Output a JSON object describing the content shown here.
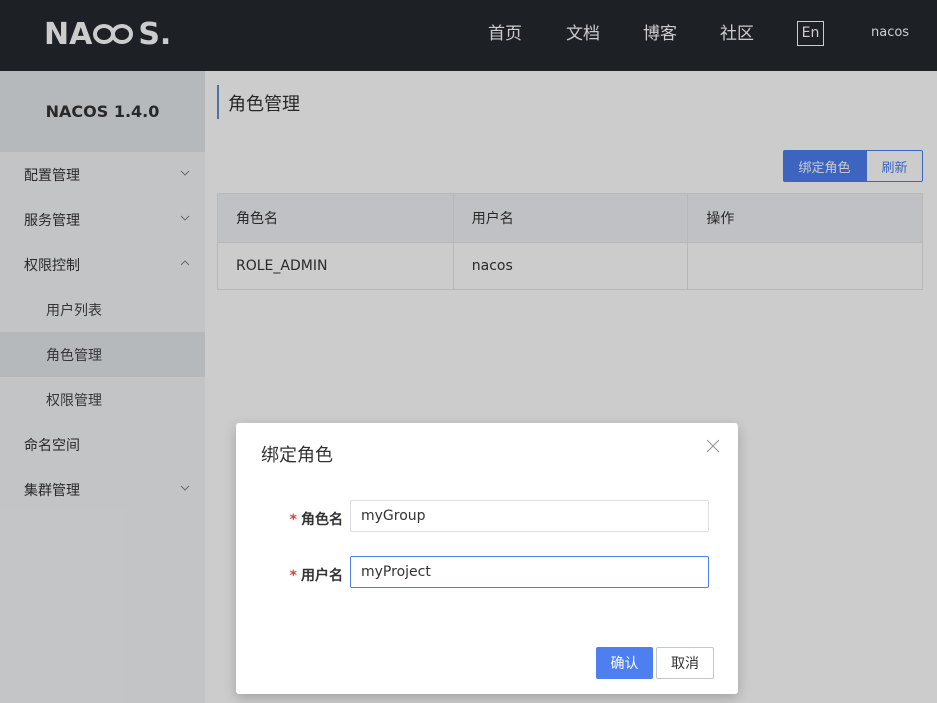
{
  "header": {
    "logo_left": "NA",
    "logo_right": "S.",
    "nav": [
      "首页",
      "文档",
      "博客",
      "社区"
    ],
    "lang": "En",
    "username": "nacos"
  },
  "sidebar": {
    "title": "NACOS 1.4.0",
    "items": [
      {
        "label": "配置管理",
        "chevron": "down"
      },
      {
        "label": "服务管理",
        "chevron": "down"
      },
      {
        "label": "权限控制",
        "chevron": "up"
      },
      {
        "label": "用户列表"
      },
      {
        "label": "角色管理",
        "active": true
      },
      {
        "label": "权限管理"
      },
      {
        "label": "命名空间"
      },
      {
        "label": "集群管理",
        "chevron": "down"
      }
    ]
  },
  "main": {
    "title": "角色管理",
    "bind_button": "绑定角色",
    "refresh_button": "刷新",
    "table": {
      "columns": [
        "角色名",
        "用户名",
        "操作"
      ],
      "rows": [
        [
          "ROLE_ADMIN",
          "nacos",
          ""
        ]
      ]
    }
  },
  "dialog": {
    "title": "绑定角色",
    "role_label": "角色名",
    "role_value": "myGroup",
    "user_label": "用户名",
    "user_value": "myProject",
    "required_mark": "*",
    "confirm": "确认",
    "cancel": "取消"
  },
  "colors": {
    "topbar": "#252a2f",
    "primary": "#4d7ff0",
    "required": "#e04040"
  }
}
